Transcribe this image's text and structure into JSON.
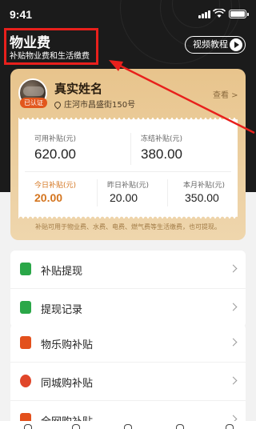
{
  "status_bar": {
    "time": "9:41"
  },
  "header": {
    "title": "物业费",
    "subtitle": "补贴物业费和生活缴费",
    "video_button_label": "视频教程"
  },
  "profile": {
    "name": "真实姓名",
    "address": "庄河市昌盛街150号",
    "verified_badge": "已认证",
    "view_link": "查看 >"
  },
  "balances": {
    "available_label": "可用补贴(元)",
    "available_value": "620.00",
    "frozen_label": "冻结补贴(元)",
    "frozen_value": "380.00",
    "today_label": "今日补贴(元)",
    "today_value": "20.00",
    "yesterday_label": "昨日补贴(元)",
    "yesterday_value": "20.00",
    "month_label": "本月补贴(元)",
    "month_value": "350.00",
    "note": "补贴可用于物业费、水费、电费、燃气费等生活缴费，也可提现。"
  },
  "menu_group_1": [
    {
      "label": "补贴提现",
      "icon": "wallet-icon"
    },
    {
      "label": "提现记录",
      "icon": "record-icon"
    }
  ],
  "menu_group_2": [
    {
      "label": "物乐购补贴",
      "icon": "bag-icon"
    },
    {
      "label": "同城购补贴",
      "icon": "location-icon"
    },
    {
      "label": "全网购补贴",
      "icon": "cart-icon"
    }
  ],
  "colors": {
    "header_bg": "#1b1b1b",
    "card_gold": "#e8c48c",
    "annotation_red": "#e8201c",
    "today_orange": "#d4751f",
    "green_icon": "#2aa748"
  }
}
